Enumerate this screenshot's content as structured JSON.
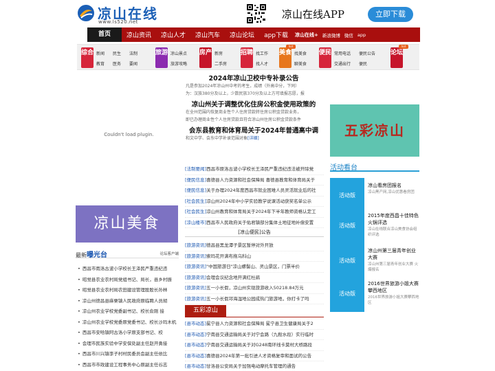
{
  "header": {
    "logo_title": "凉山在线",
    "logo_url": "www.ls520.net",
    "app_title": "凉山在线APP",
    "download_label": "立即下载"
  },
  "nav": {
    "home": "首页",
    "items": [
      "凉山资讯",
      "凉山人才",
      "凉山汽车",
      "凉山论坛",
      "app下载",
      "凉山在线+"
    ],
    "small_items": [
      "新浪微博",
      "微信",
      "app"
    ]
  },
  "categories": [
    {
      "badge": "综合",
      "color": "#d6253a",
      "links": [
        "新闻",
        "民生",
        "法制",
        "教育",
        "医务",
        "要闻"
      ]
    },
    {
      "badge": "旅游",
      "color": "#8c2bb0",
      "links": [
        "凉山景点",
        "旅游攻略"
      ]
    },
    {
      "badge": "房产",
      "color": "#c6152a",
      "links": [
        "新房",
        "二手房"
      ]
    },
    {
      "badge": "招聘",
      "color": "#d6253a",
      "links": [
        "找工作",
        "找人才"
      ]
    },
    {
      "badge": "美食",
      "color": "#e7761d",
      "links": [
        "找美食",
        "聊美食"
      ],
      "hot": "hot"
    },
    {
      "badge": "便民",
      "color": "#d6253a",
      "links": [
        "常用电话",
        "便民公告",
        "交通出行",
        "便民"
      ]
    },
    {
      "badge": "论坛",
      "color": "#c6152a",
      "links": [],
      "hot": "hot"
    }
  ],
  "left": {
    "plugin_text": "Couldn't load plugin.",
    "food_banner": "凉山美食",
    "exposure_prefix": "最新",
    "exposure_title": "曝光台",
    "exposure_more": "论坛客户端",
    "exposure_items": [
      "西昌市雨洛古波小学校长王泽民严重违纪违",
      "昭觉县农业农村局党组书记、局长，县乡村振",
      "昭觉县农业农村局农田建设管理股股长孙林",
      "凉山州德昌县麻栗镇人民政府原临聘人员胡",
      "凉山州农业学校党委副书记、校长俞刚 接",
      "凉山州农业学校党委原党委书记、校长沙玛木机",
      "西昌市安哈镇阿古洛小学原支部书记、校",
      "会理市民族实验中学安保处副主任赵开勇接",
      "西昌市川兴镇李子村村民委员会副主任依比",
      "西昌市市政建设工程事务中心原副主任谷志"
    ]
  },
  "center": {
    "headlines": [
      {
        "title": "2024年凉山卫校中专补录公告",
        "lines": [
          "凡是参加2024年凉山州中考的考生，成绩（外高中分，下同）",
          "为：汉族380分及以上，少数民族370分及以上方可填报志愿，报"
        ]
      },
      {
        "title": "凉山州关于调整优化住房公积金使用政策的",
        "lines": [
          "在全州范围内恢复商业性个人住房贷款转住房公积金贷款业务，",
          "即已办理商业性个人住房贷款且符合凉山州住房公积金贷款条件"
        ]
      },
      {
        "title": "会东县教育和体育局关于2024年普通高中调",
        "lines": [
          "和文中学、会东中学补录范围对象"
        ],
        "link": "[详细]"
      }
    ],
    "news1": [
      {
        "tag": "[法制要闻]",
        "text": "西昌市原洛古波小学校长王泽民严重违纪违法被开除党"
      },
      {
        "tag": "[便民信息]",
        "text": "喜德县人力资源和社会保障局 喜德县教育和体育局关于"
      },
      {
        "tag": "[便民信息]",
        "text": "关于办理2024年度西昌市就业困难人员灵活就业后的社"
      },
      {
        "tag": "[社会民生]",
        "text": "凉山州2024年中小学实验教学说课活动获奖名单公示"
      },
      {
        "tag": "[社会民生]",
        "text": "凉山州教育和体育局关于2024年下半年教师资格认定工"
      },
      {
        "tag": "[凉山楼市]",
        "text": "西昌市人民政府关于佑君镇部分集体土地征地补偿安置"
      }
    ],
    "convenience_title": "[凉山便民]公告",
    "news2": [
      {
        "tag": "[旅游资讯]",
        "text": "德昌县黑龙潭子景区暂停对外开放"
      },
      {
        "tag": "[旅游资讯]",
        "text": "索玛花开满布拖乌科山"
      },
      {
        "tag": "[旅游资讯]",
        "text": "\"中国旅游日\"凉山螺髻山、灵山景区，门票半价"
      },
      {
        "tag": "[旅游资讯]",
        "text": "会理会议纪念地开满红杜鹃"
      },
      {
        "tag": "[旅游资讯]",
        "text": "五一小长假，凉山州实现旅游收入50218.84万元"
      },
      {
        "tag": "[旅游资讯]",
        "text": "五一小长假邛海湿地公园成热门旅游地，你打卡了吗"
      }
    ],
    "wucai_label": "五彩凉山",
    "news3": [
      {
        "tag": "[县市动态]",
        "text": "冕宁县人力资源和社会保障局 冕宁县卫生健康局关于2"
      },
      {
        "tag": "[县市动态]",
        "text": "宁南县交通运输局关于对宁会路（九殺水段）实行临时"
      },
      {
        "tag": "[县市动态]",
        "text": "宁南县交通运输局关于对G248南环线卡莫村大桥路段"
      },
      {
        "tag": "[县市动态]",
        "text": "喜德县2024年第一批引进人才资格复审和面试的公告"
      },
      {
        "tag": "[县市动态]",
        "text": "甘洛县公安局关于加强电动摩托车管理的通告"
      }
    ]
  },
  "right": {
    "wucai_banner": "五彩凉山",
    "activity_title": "活动看台",
    "activity_block": "活动版",
    "activities": [
      {
        "title": "凉山看房团报名",
        "desc": "凉山黑产网,凉山优惠看房团"
      },
      {
        "title": "2015年度西昌十佳特色火锅评选",
        "desc": "凉山在线联合凉山美食协会组织评选"
      },
      {
        "title": "凉山州第三届青年创业大赛",
        "desc": "凉山州第三届青年创业大赛 火爆报名"
      },
      {
        "title": "2016世界旅游小姐大赛攀西地区",
        "desc": "2016世界旅游小姐大赛攀西地区"
      }
    ]
  }
}
